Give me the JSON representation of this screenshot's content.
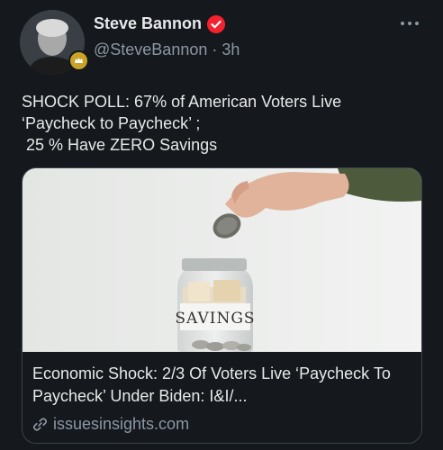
{
  "author": {
    "display_name": "Steve Bannon",
    "handle": "@SteveBannon",
    "separator": "·",
    "time": "3h"
  },
  "tweet": {
    "text": "SHOCK POLL: 67% of American Voters Live\n‘Paycheck to Paycheck’ ;\n 25 % Have ZERO Savings"
  },
  "card": {
    "jar_label": "SAVINGS",
    "title": "Economic Shock: 2/3 Of Voters Live ‘Paycheck To Paycheck’ Under Biden: I&I/...",
    "domain": "issuesinsights.com"
  },
  "colors": {
    "background": "#15181c",
    "text_primary": "#e7e9ea",
    "text_secondary": "#8b98a5",
    "verified_badge": "#f4212e",
    "card_border": "#38444d"
  },
  "icons": {
    "verified": "verified-badge-icon",
    "more": "more-horizontal-icon",
    "link": "link-icon"
  }
}
